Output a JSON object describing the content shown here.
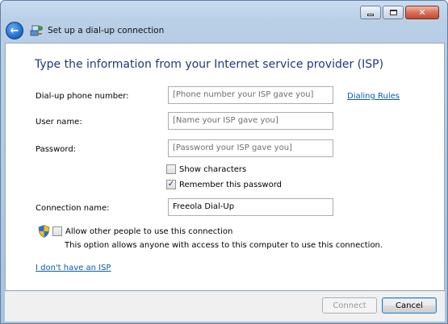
{
  "window": {
    "title": "Set up a dial-up connection"
  },
  "page": {
    "heading": "Type the information from your Internet service provider (ISP)"
  },
  "form": {
    "phone": {
      "label": "Dial-up phone number:",
      "placeholder": "[Phone number your ISP gave you]"
    },
    "username": {
      "label": "User name:",
      "placeholder": "[Name your ISP gave you]"
    },
    "password": {
      "label": "Password:",
      "placeholder": "[Password your ISP gave you]"
    },
    "show_characters": {
      "label": "Show characters",
      "checked": false
    },
    "remember_password": {
      "label": "Remember this password",
      "checked": true
    },
    "connection_name": {
      "label": "Connection name:",
      "value": "Freeola Dial-Up"
    },
    "allow_others": {
      "label": "Allow other people to use this connection",
      "description": "This option allows anyone with access to this computer to use this connection.",
      "checked": false
    }
  },
  "links": {
    "dialing_rules": "Dialing Rules",
    "no_isp": "I don't have an ISP"
  },
  "buttons": {
    "connect": "Connect",
    "cancel": "Cancel"
  },
  "icons": {
    "back": "back-arrow-icon",
    "dialup": "dialup-connection-icon",
    "shield": "uac-shield-icon"
  },
  "colors": {
    "heading": "#1e3a78",
    "link": "#0b5aa8"
  }
}
